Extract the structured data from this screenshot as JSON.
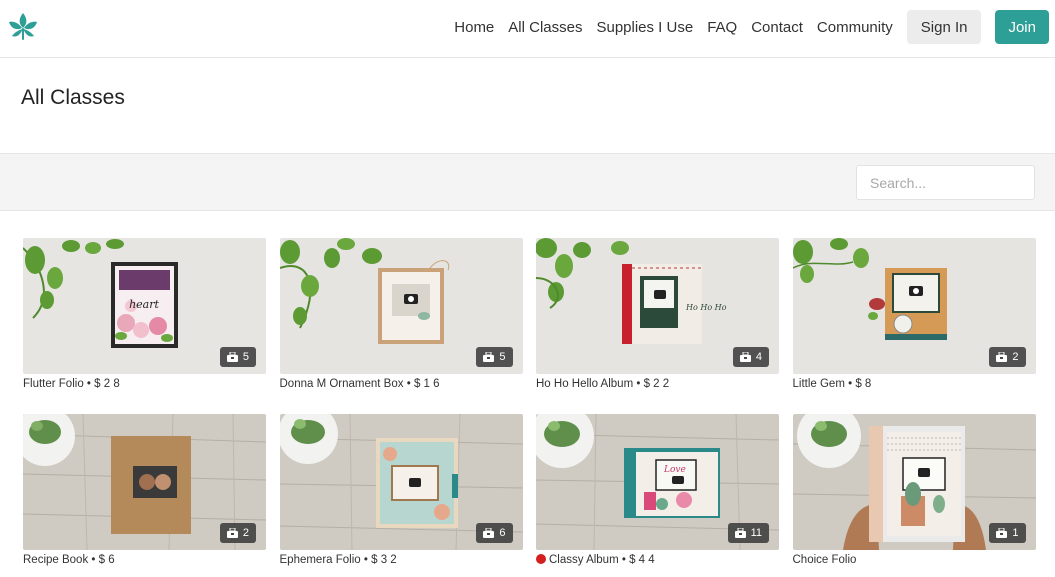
{
  "nav": {
    "links": [
      "Home",
      "All Classes",
      "Supplies I Use",
      "FAQ",
      "Contact",
      "Community"
    ],
    "signin_label": "Sign In",
    "join_label": "Join",
    "logo_icon": "leaf-logo-icon",
    "accent_color": "#2e9f96"
  },
  "page": {
    "title": "All Classes"
  },
  "search": {
    "placeholder": "Search..."
  },
  "classes": [
    {
      "name": "Flutter Folio",
      "price": "$ 2 8",
      "count": "5",
      "scene": "folio-pink"
    },
    {
      "name": "Donna M Ornament Box",
      "price": "$ 1 6",
      "count": "5",
      "scene": "ornament-box"
    },
    {
      "name": "Ho Ho Hello Album",
      "price": "$ 2 2",
      "count": "4",
      "scene": "hoho-album"
    },
    {
      "name": "Little Gem",
      "price": "$ 8",
      "count": "2",
      "scene": "little-gem"
    },
    {
      "name": "Recipe Book",
      "price": "$ 6",
      "count": "2",
      "scene": "recipe-book"
    },
    {
      "name": "Ephemera Folio",
      "price": "$ 3 2",
      "count": "6",
      "scene": "ephemera-folio"
    },
    {
      "name": "Classy Album",
      "price": "$ 4 4",
      "count": "11",
      "scene": "classy-album",
      "marker": "red-dot"
    },
    {
      "name": "Choice Folio",
      "price": "",
      "count": "1",
      "scene": "choice-folio"
    }
  ]
}
